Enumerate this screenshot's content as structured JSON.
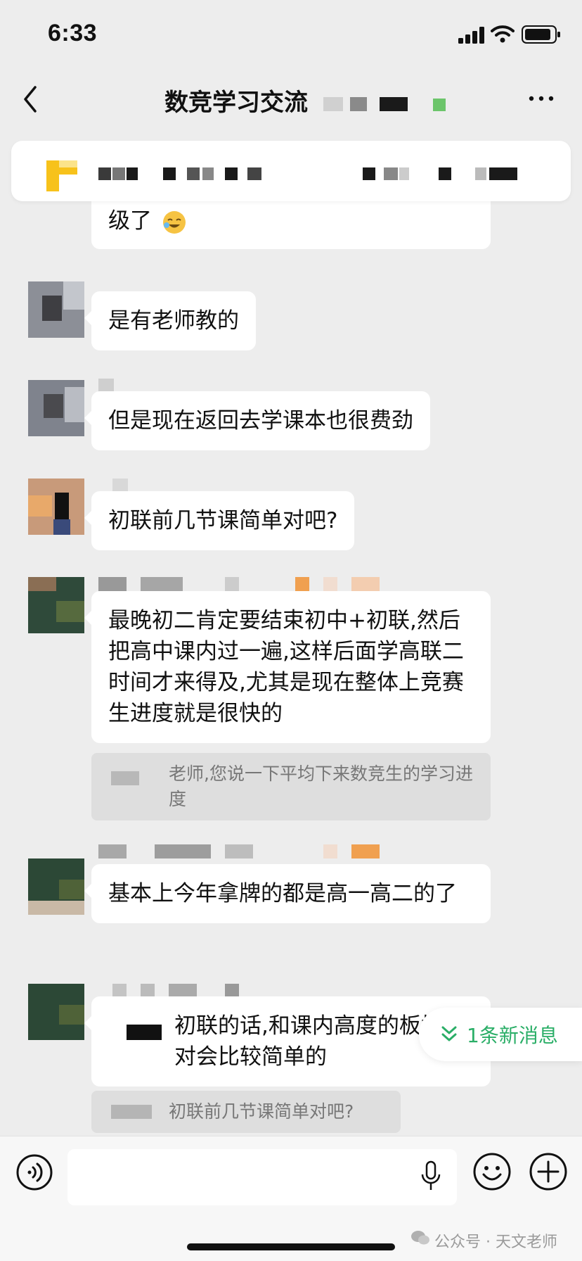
{
  "status_bar": {
    "time": "6:33"
  },
  "nav": {
    "title": "数竞学习交流"
  },
  "messages": [
    {
      "text": "级了"
    },
    {
      "text": "是有老师教的"
    },
    {
      "text": "但是现在返回去学课本也很费劲"
    },
    {
      "text": "初联前几节课简单对吧?"
    },
    {
      "text": "最晚初二肯定要结束初中+初联,然后把高中课内过一遍,这样后面学高联二时间才来得及,尤其是现在整体上竞赛生进度就是很快的"
    },
    {
      "text": "基本上今年拿牌的都是高一高二的了"
    },
    {
      "text": "初联的话,和课内高度的板块相对会比较简单的"
    }
  ],
  "quotes": [
    {
      "text": "老师,您说一下平均下来数竞生的学习进度"
    },
    {
      "text": "初联前几节课简单对吧?"
    }
  ],
  "new_messages": {
    "label": "1条新消息"
  },
  "footer": {
    "watermark": "公众号 · 天文老师"
  },
  "colors": {
    "background": "#ededed",
    "bubble": "#ffffff",
    "accent_green": "#2aae67",
    "quote_bg": "#dedede"
  },
  "icons": [
    "back-icon",
    "more-icon",
    "voice-icon",
    "mic-icon",
    "emoji-icon",
    "plus-icon",
    "double-chevron-down-icon",
    "signal-icon",
    "wifi-icon",
    "battery-icon",
    "wechat-icon"
  ]
}
